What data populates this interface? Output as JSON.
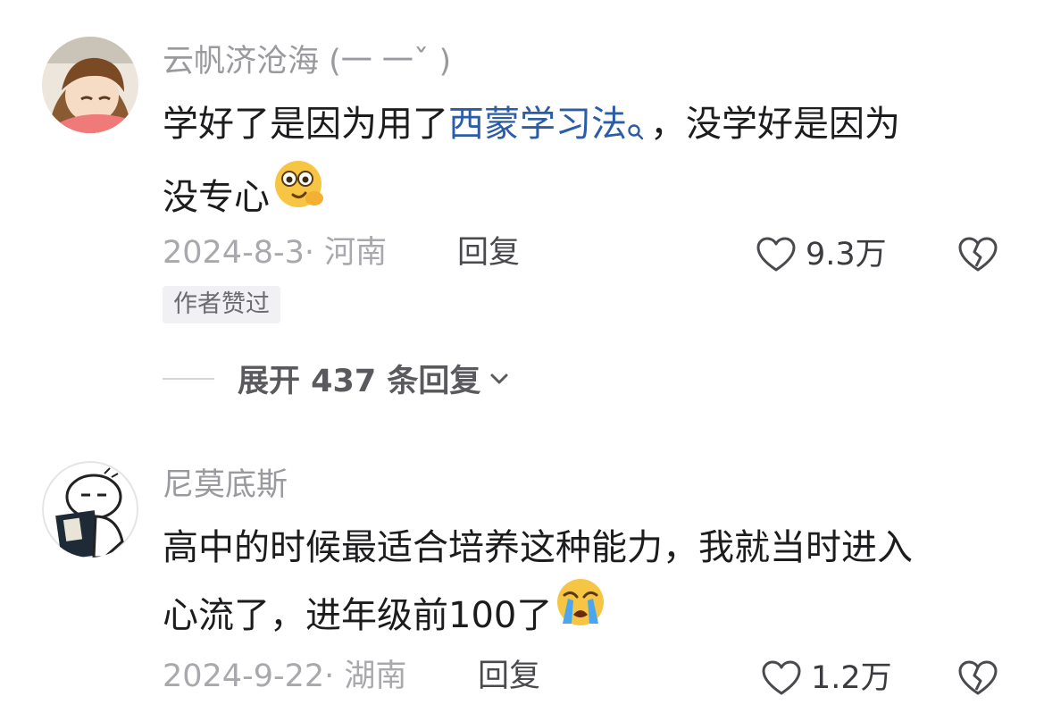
{
  "comments": [
    {
      "username": "云帆济沧海 (一 一ˇ )",
      "text_line1_before": "学好了是因为用了",
      "link_text": "西蒙学习法",
      "text_line1_after": "，没学好是因为",
      "text_line2": "没专心",
      "emoji": "thinking-face-emoji",
      "meta": "2024-8-3· 河南",
      "reply_label": "回复",
      "likes": "9.3万",
      "badge": "作者赞过",
      "expand_label": "展开 437 条回复"
    },
    {
      "username": "尼莫底斯",
      "text_line1": "高中的时候最适合培养这种能力，我就当时进入",
      "text_line2": "心流了，进年级前100了",
      "emoji": "loudly-crying-face-emoji",
      "meta": "2024-9-22· 湖南",
      "reply_label": "回复",
      "likes": "1.2万"
    }
  ],
  "colors": {
    "link": "#2a5ca8",
    "username": "#9a9a9e",
    "text": "#1c1c1e",
    "meta": "#a9a9ad"
  }
}
